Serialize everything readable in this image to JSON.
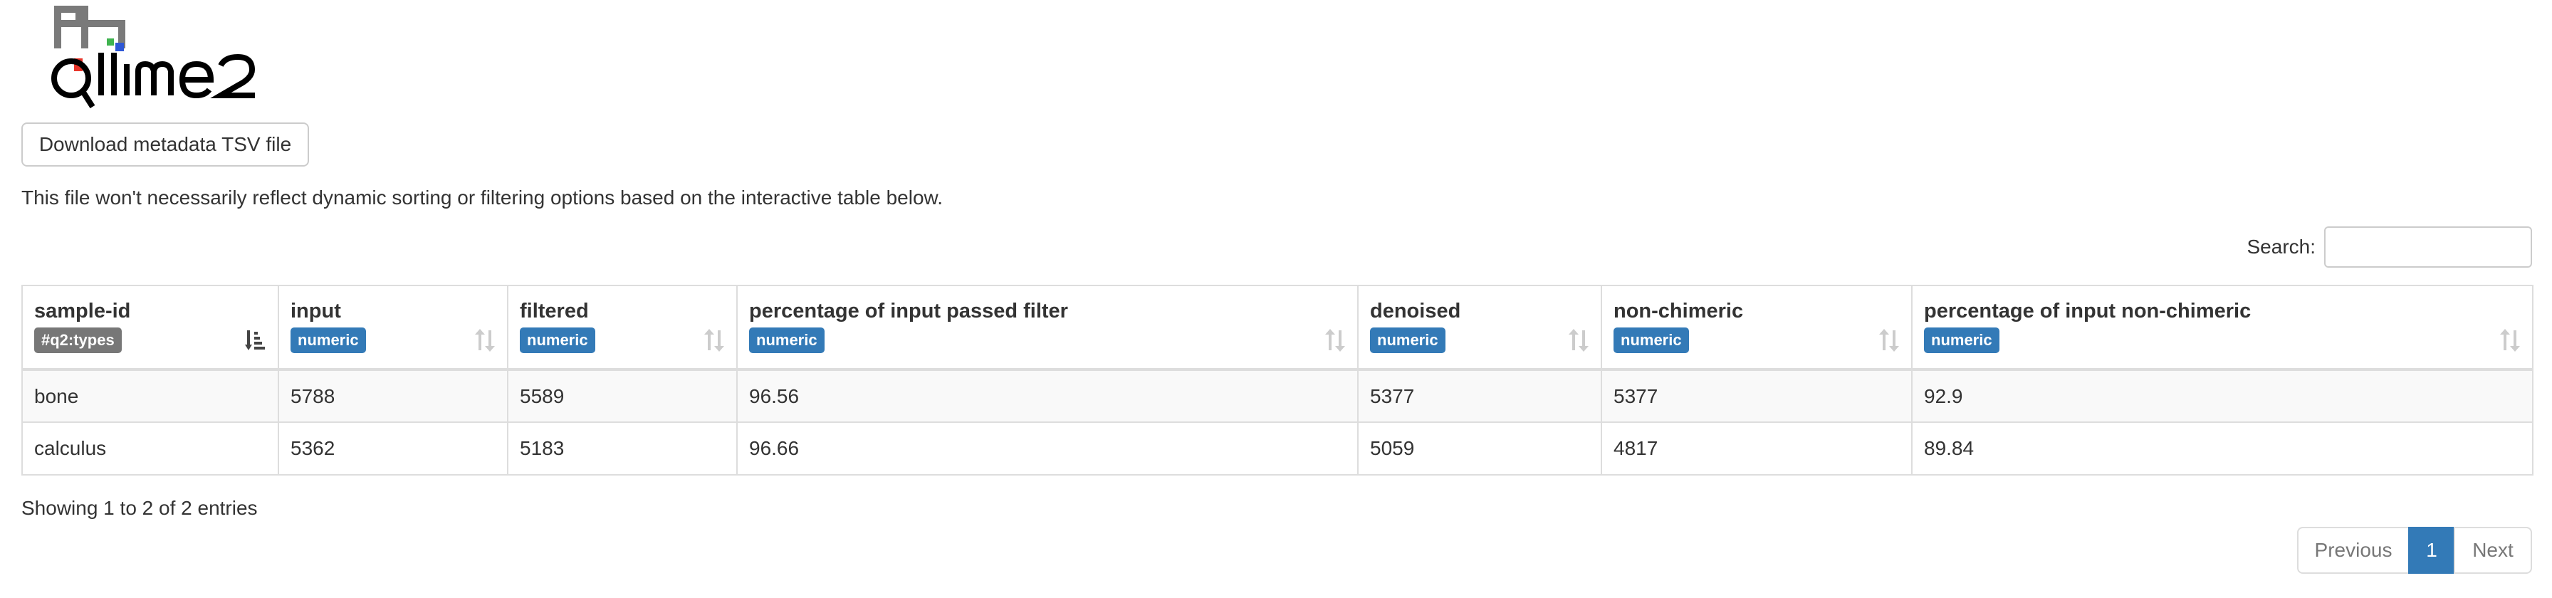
{
  "logo": {
    "text": "qiime2"
  },
  "download_button": {
    "label": "Download metadata TSV file"
  },
  "note": "This file won't necessarily reflect dynamic sorting or filtering options based on the interactive table below.",
  "search": {
    "label": "Search:",
    "value": "",
    "placeholder": ""
  },
  "colors": {
    "types_badge": "#777777",
    "numeric_badge": "#337ab7",
    "active_page": "#337ab7",
    "logo_gray": "#7a7a7a",
    "logo_red": "#e8352a",
    "logo_green": "#3fb34f",
    "logo_blue": "#2e57d6"
  },
  "table": {
    "columns": [
      {
        "title": "sample-id",
        "badge": "#q2:types",
        "badge_color": "#777777",
        "sort_icon": "sort-active-icon"
      },
      {
        "title": "input",
        "badge": "numeric",
        "badge_color": "#337ab7",
        "sort_icon": "sort-both-icon"
      },
      {
        "title": "filtered",
        "badge": "numeric",
        "badge_color": "#337ab7",
        "sort_icon": "sort-both-icon"
      },
      {
        "title": "percentage of input passed filter",
        "badge": "numeric",
        "badge_color": "#337ab7",
        "sort_icon": "sort-both-icon"
      },
      {
        "title": "denoised",
        "badge": "numeric",
        "badge_color": "#337ab7",
        "sort_icon": "sort-both-icon"
      },
      {
        "title": "non-chimeric",
        "badge": "numeric",
        "badge_color": "#337ab7",
        "sort_icon": "sort-both-icon"
      },
      {
        "title": "percentage of input non-chimeric",
        "badge": "numeric",
        "badge_color": "#337ab7",
        "sort_icon": "sort-both-icon"
      }
    ],
    "rows": [
      [
        "bone",
        "5788",
        "5589",
        "96.56",
        "5377",
        "5377",
        "92.9"
      ],
      [
        "calculus",
        "5362",
        "5183",
        "96.66",
        "5059",
        "4817",
        "89.84"
      ]
    ]
  },
  "info": "Showing 1 to 2 of 2 entries",
  "pagination": {
    "previous": "Previous",
    "current": "1",
    "next": "Next"
  }
}
